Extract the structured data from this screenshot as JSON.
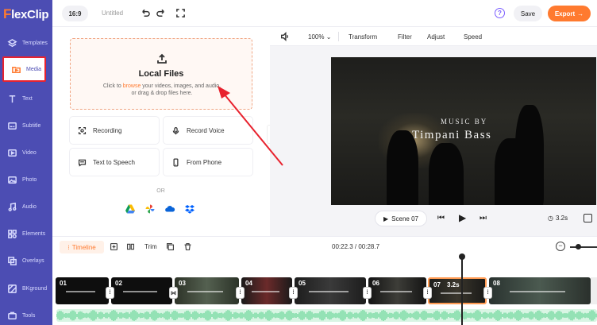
{
  "sidebar": {
    "logo": "FlexClip",
    "items": [
      {
        "label": "Templates",
        "icon": "layers-icon"
      },
      {
        "label": "Media",
        "icon": "folder-icon",
        "active": true
      },
      {
        "label": "Text",
        "icon": "text-icon"
      },
      {
        "label": "Subtitle",
        "icon": "subtitle-icon"
      },
      {
        "label": "Video",
        "icon": "video-icon"
      },
      {
        "label": "Photo",
        "icon": "photo-icon"
      },
      {
        "label": "Audio",
        "icon": "music-icon"
      },
      {
        "label": "Elements",
        "icon": "elements-icon"
      },
      {
        "label": "Overlays",
        "icon": "overlays-icon"
      },
      {
        "label": "BKground",
        "icon": "background-icon"
      },
      {
        "label": "Tools",
        "icon": "tools-icon"
      }
    ]
  },
  "topbar": {
    "ratio": "16:9",
    "project_name": "Untitled",
    "save_label": "Save",
    "export_label": "Export",
    "help_glyph": "?"
  },
  "media_panel": {
    "upload_title": "Local Files",
    "upload_desc_before": "Click to ",
    "upload_desc_link": "browse",
    "upload_desc_after": " your videos, images, and audio, or drag & drop files here.",
    "options": [
      {
        "label": "Recording",
        "icon": "record-icon"
      },
      {
        "label": "Record Voice",
        "icon": "microphone-icon"
      },
      {
        "label": "Text to Speech",
        "icon": "speech-icon"
      },
      {
        "label": "From Phone",
        "icon": "phone-icon"
      }
    ],
    "or_label": "OR",
    "cloud_sources": [
      "google-drive-icon",
      "google-photos-icon",
      "onedrive-icon",
      "dropbox-icon"
    ]
  },
  "preview": {
    "volume_icon": "volume-icon",
    "zoom": "100%",
    "tools": [
      "Transform",
      "Filter",
      "Adjust",
      "Speed"
    ],
    "video_text_small": "MUSIC BY",
    "video_text_large": "Timpani Bass",
    "scene_label": "Scene 07",
    "duration": "3.2s"
  },
  "timeline": {
    "label": "Timeline",
    "trim_label": "Trim",
    "timecode": "00:22.3 / 00:28.7",
    "clips": [
      {
        "num": "01"
      },
      {
        "num": "02"
      },
      {
        "num": "03"
      },
      {
        "num": "04"
      },
      {
        "num": "05"
      },
      {
        "num": "06"
      },
      {
        "num": "07",
        "duration": "3.2s",
        "selected": true
      },
      {
        "num": "08"
      }
    ]
  },
  "colors": {
    "sidebar": "#4c4db3",
    "accent": "#ff7a2f",
    "annotation": "#e8222e"
  }
}
